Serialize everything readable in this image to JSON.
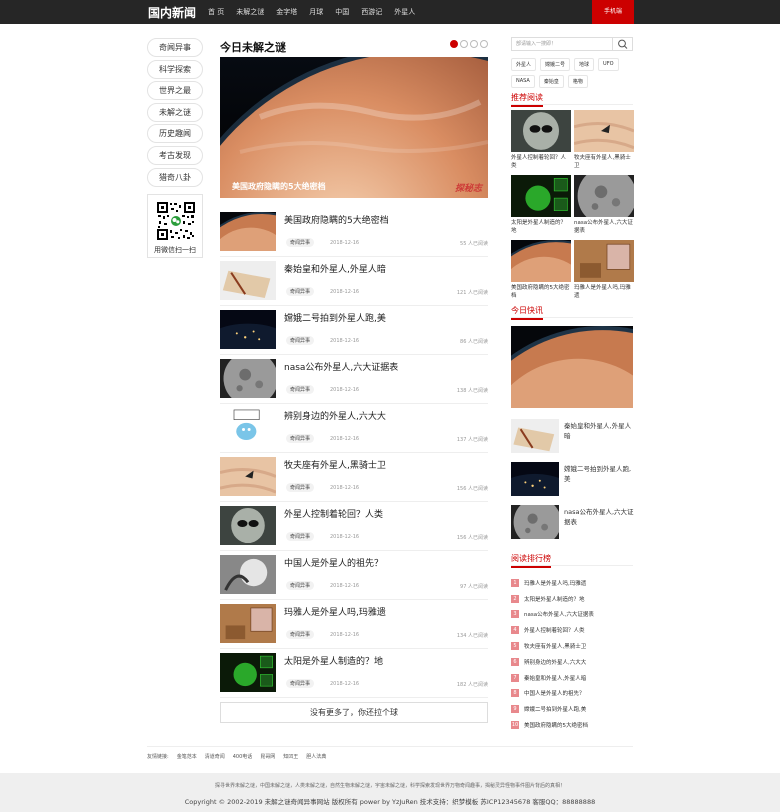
{
  "site": {
    "logo": "国内新闻",
    "phone_button": "手机端"
  },
  "nav": [
    "首 页",
    "未解之谜",
    "金字塔",
    "月球",
    "中国",
    "西游记",
    "外星人"
  ],
  "left_menu": [
    "奇闻异事",
    "科学探索",
    "世界之最",
    "未解之谜",
    "历史趣闻",
    "考古发现",
    "猎奇八卦"
  ],
  "qr_label": "用微信扫一扫",
  "main": {
    "title": "今日未解之谜",
    "banner_caption": "美国政府隐瞒的5大绝密档",
    "banner_watermark": "探秘志",
    "articles": [
      {
        "title": "美国政府隐瞒的5大绝密档",
        "category": "奇闻异事",
        "date": "2018-12-16",
        "views": "55 人已阅读",
        "thumb": "planet"
      },
      {
        "title": "秦始皇和外星人,外星人暗",
        "category": "奇闻异事",
        "date": "2018-12-16",
        "views": "121 人已阅读",
        "thumb": "paper"
      },
      {
        "title": "嫦娥二号拍到外星人跑,美",
        "category": "奇闻异事",
        "date": "2018-12-16",
        "views": "86 人已阅读",
        "thumb": "earthnight"
      },
      {
        "title": "nasa公布外星人,六大证据表",
        "category": "奇闻异事",
        "date": "2018-12-16",
        "views": "138 人已阅读",
        "thumb": "moon"
      },
      {
        "title": "辨别身边的外星人,六大大",
        "category": "奇闻异事",
        "date": "2018-12-16",
        "views": "137 人已阅读",
        "thumb": "cartoon"
      },
      {
        "title": "牧夫座有外星人,黑骑士卫",
        "category": "奇闻异事",
        "date": "2018-12-16",
        "views": "156 人已阅读",
        "thumb": "sand"
      },
      {
        "title": "外星人控制着轮回？人类",
        "category": "奇闻异事",
        "date": "2018-12-16",
        "views": "156 人已阅读",
        "thumb": "alien"
      },
      {
        "title": "中国人是外星人的祖先？",
        "category": "奇闻异事",
        "date": "2018-12-16",
        "views": "97 人已阅读",
        "thumb": "bw"
      },
      {
        "title": "玛雅人是外星人吗,玛雅遗",
        "category": "奇闻异事",
        "date": "2018-12-16",
        "views": "134 人已阅读",
        "thumb": "maya"
      },
      {
        "title": "太阳是外星人制造的？地",
        "category": "奇闻异事",
        "date": "2018-12-16",
        "views": "182 人已阅读",
        "thumb": "green"
      }
    ],
    "more_button": "没有更多了，你还拉个球"
  },
  "sidebar": {
    "search_placeholder": "部请输入一搜即！",
    "tags": [
      "外星人",
      "嫦娥二号",
      "地球",
      "UFO",
      "NASA",
      "秦始皇",
      "格物"
    ],
    "recommend_title": "推荐阅读",
    "recommend": [
      {
        "title": "外星人控制着轮回？人类",
        "thumb": "alien"
      },
      {
        "title": "牧夫座有外星人,黑骑士卫",
        "thumb": "sand"
      },
      {
        "title": "太阳是外星人制造的？地",
        "thumb": "green"
      },
      {
        "title": "nasa公布外星人,六大证据表",
        "thumb": "moon"
      },
      {
        "title": "美国政府隐瞒的5大绝密档",
        "thumb": "planet"
      },
      {
        "title": "玛雅人是外星人吗,玛雅遗",
        "thumb": "maya"
      }
    ],
    "today_title": "今日快讯",
    "today_small": [
      {
        "title": "秦始皇和外星人,外星人暗",
        "thumb": "paper"
      },
      {
        "title": "嫦娥二号拍到外星人跑,美",
        "thumb": "earthnight"
      },
      {
        "title": "nasa公布外星人,六大证据表",
        "thumb": "moon"
      }
    ],
    "rank_title": "阅读排行榜",
    "rank": [
      {
        "no": "1",
        "title": "玛雅人是外星人吗,玛雅遗"
      },
      {
        "no": "2",
        "title": "太阳是外星人制造的？地"
      },
      {
        "no": "3",
        "title": "nasa公布外星人,六大证据表"
      },
      {
        "no": "4",
        "title": "外星人控制着轮回？人类"
      },
      {
        "no": "5",
        "title": "牧夫座有外星人,黑骑士卫"
      },
      {
        "no": "6",
        "title": "辨别身边的外星人,六大大"
      },
      {
        "no": "7",
        "title": "秦始皇和外星人,外星人暗"
      },
      {
        "no": "8",
        "title": "中国人是外星人的祖先？"
      },
      {
        "no": "9",
        "title": "嫦娥二号拍到外星人跑,美"
      },
      {
        "no": "10",
        "title": "美国政府隐瞒的5大绝密档"
      }
    ]
  },
  "friend_links": [
    "友情链接:",
    "金笔范本",
    "清道奇闻",
    "400电话",
    "昆哥网",
    "知凹王",
    "胆人法典"
  ],
  "footer": {
    "line1": "探寻世界未解之谜，中国未解之谜，人类未解之谜，自然生物未解之谜，宇宙未解之谜，科学探索发现世界万物奇闻趣事，揭秘灵异怪物事件图片背后的真相！",
    "line2": "Copyright © 2002-2019 未解之谜奇闻异事网站 版权所有 power by YzJuRen  技术支持：织梦模板  苏ICP12345678  客服QQ：88888888"
  },
  "colors": {
    "accent": "#cc0000",
    "topbar": "#262626",
    "footer": "#efefef"
  }
}
